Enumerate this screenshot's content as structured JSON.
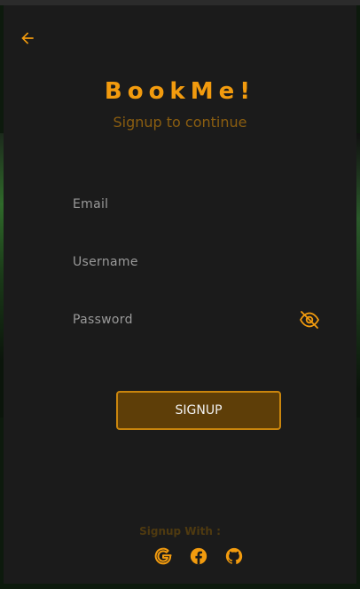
{
  "app": {
    "brand": "BookMe!",
    "subtitle": "Signup to continue"
  },
  "form": {
    "email_placeholder": "Email",
    "email_value": "",
    "username_placeholder": "Username",
    "username_value": "",
    "password_placeholder": "Password",
    "password_value": "",
    "submit_label": "SIGNUP"
  },
  "social": {
    "heading": "Signup With :",
    "providers": [
      {
        "name": "Google",
        "icon": "google-icon"
      },
      {
        "name": "Facebook",
        "icon": "facebook-icon"
      },
      {
        "name": "GitHub",
        "icon": "github-icon"
      }
    ]
  },
  "colors": {
    "accent": "#f29b0e",
    "subtitle": "#8a5d10",
    "button_bg": "#5e3e08",
    "button_border": "#c9850d",
    "card_bg": "#1b1b1b"
  },
  "icons": {
    "back": "arrow-left-icon",
    "password_toggle": "eye-off-icon"
  }
}
